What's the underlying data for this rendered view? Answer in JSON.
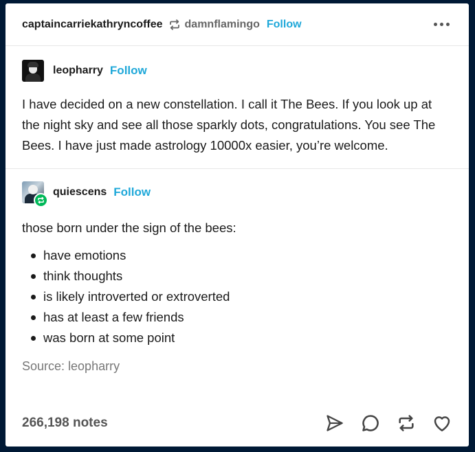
{
  "header": {
    "blog_name": "captaincarriekathryncoffee",
    "reblog_icon": "reblog-icon",
    "via_name": "damnflamingo",
    "follow_label": "Follow",
    "more_icon": "more-options-icon"
  },
  "posts": [
    {
      "author": "leopharry",
      "follow_label": "Follow",
      "text": "I have decided on a new constellation. I call it The Bees. If you look up at the night sky and see all those sparkly dots, congratulations. You see The Bees. I have just made astrology 10000x easier, you’re welcome."
    },
    {
      "author": "quiescens",
      "follow_label": "Follow",
      "text": "those born under the sign of the bees:",
      "list": [
        "have emotions",
        "think thoughts",
        "is likely introverted or extroverted",
        "has at least a few friends",
        "was born at some point"
      ],
      "source": "Source: leopharry"
    }
  ],
  "footer": {
    "notes": "266,198 notes",
    "icons": [
      "share-icon",
      "reply-icon",
      "reblog-icon",
      "like-icon"
    ]
  },
  "colors": {
    "background": "#001935",
    "accent": "#1fa8d9",
    "reblog_green": "#00b858"
  }
}
